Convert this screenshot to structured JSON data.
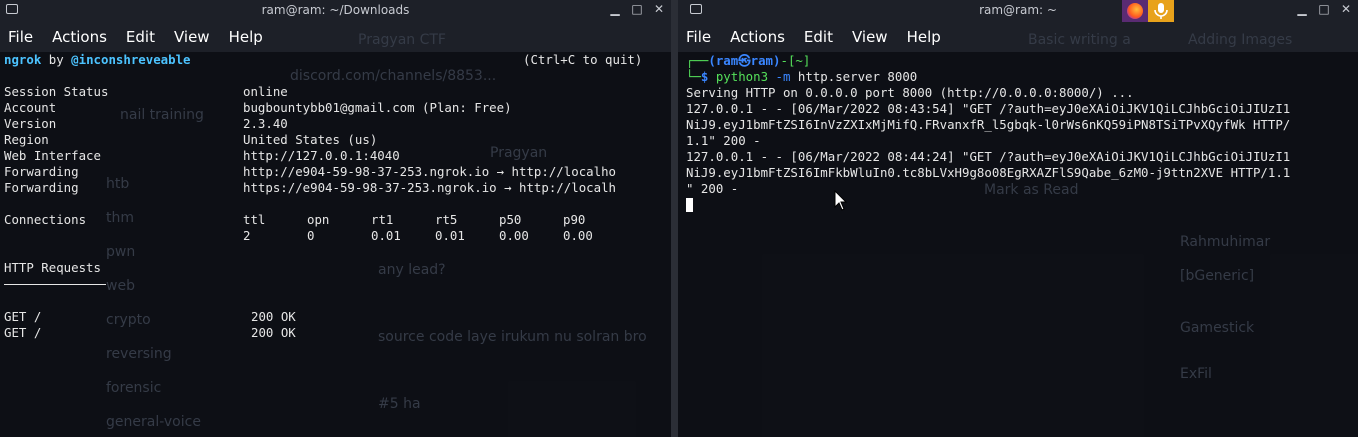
{
  "left": {
    "title": "ram@ram: ~/Downloads",
    "menu": [
      "File",
      "Actions",
      "Edit",
      "View",
      "Help"
    ],
    "ngrok_name": "ngrok",
    "ngrok_by": " by ",
    "ngrok_handle": "@inconshreveable",
    "quit_hint": "(Ctrl+C to quit)",
    "fields": [
      {
        "label": "Session Status",
        "value": "online"
      },
      {
        "label": "Account",
        "value": "bugbountybb01@gmail.com (Plan: Free)"
      },
      {
        "label": "Version",
        "value": "2.3.40"
      },
      {
        "label": "Region",
        "value": "United States (us)"
      },
      {
        "label": "Web Interface",
        "value": "http://127.0.0.1:4040"
      },
      {
        "label": "Forwarding",
        "value": "http://e904-59-98-37-253.ngrok.io → http://localho"
      },
      {
        "label": "Forwarding",
        "value": "https://e904-59-98-37-253.ngrok.io → http://localh"
      }
    ],
    "connections": {
      "label": "Connections",
      "headers": [
        "ttl",
        "opn",
        "rt1",
        "rt5",
        "p50",
        "p90"
      ],
      "values": [
        "2",
        "0",
        "0.01",
        "0.01",
        "0.00",
        "0.00"
      ]
    },
    "http_requests_label": "HTTP Requests",
    "requests": [
      {
        "method": "GET /",
        "status": "200 OK"
      },
      {
        "method": "GET /",
        "status": "200 OK"
      }
    ],
    "background_ghost": [
      "Pragyan CTF",
      "discord.com/channels/8853...",
      "nail training",
      "Pragyan",
      "htb",
      "thm",
      "pwn",
      "web",
      "crypto",
      "reversing",
      "forensic",
      "general-voice",
      "any lead?",
      "source code laye irukum nu solran bro",
      "#5 ha"
    ]
  },
  "right": {
    "title": "ram@ram: ~",
    "menu": [
      "File",
      "Actions",
      "Edit",
      "View",
      "Help"
    ],
    "prompt_user": "(ram㉿ram)",
    "prompt_dir": "[~]",
    "command": "python3",
    "command_flag": "-m",
    "command_rest": " http.server 8000",
    "output": [
      "Serving HTTP on 0.0.0.0 port 8000 (http://0.0.0.0:8000/) ...",
      "127.0.0.1 - - [06/Mar/2022 08:43:54] \"GET /?auth=eyJ0eXAiOiJKV1QiLCJhbGciOiJIUzI1",
      "NiJ9.eyJ1bmFtZSI6InVzZXIxMjMifQ.FRvanxfR_l5gbqk-l0rWs6nKQ59iPN8TSiTPvXQyfWk HTTP/",
      "1.1\" 200 -",
      "127.0.0.1 - - [06/Mar/2022 08:44:24] \"GET /?auth=eyJ0eXAiOiJKV1QiLCJhbGciOiJIUzI1",
      "NiJ9.eyJ1bmFtZSI6ImFkbWluIn0.tc8bLVxH9g8o08EgRXAZFlS9Qabe_6zM0-j9ttn2XVE HTTP/1.1",
      "\" 200 -"
    ],
    "background_ghost": [
      "Basic writing a",
      "Adding Images",
      "Mark as Read",
      "Rahmuhimar",
      "[bGeneric]",
      "Gamestick",
      "ExFil"
    ]
  },
  "colors": {
    "prompt_green": "#55e05a",
    "prompt_blue": "#3a86ff",
    "ngrok_cyan": "#4cc3ff",
    "mic_orange": "#e8a21b",
    "firefox_purple": "#5a2b73"
  },
  "icons": {
    "window": "terminal-icon",
    "tray": [
      "firefox-icon",
      "microphone-icon"
    ]
  }
}
